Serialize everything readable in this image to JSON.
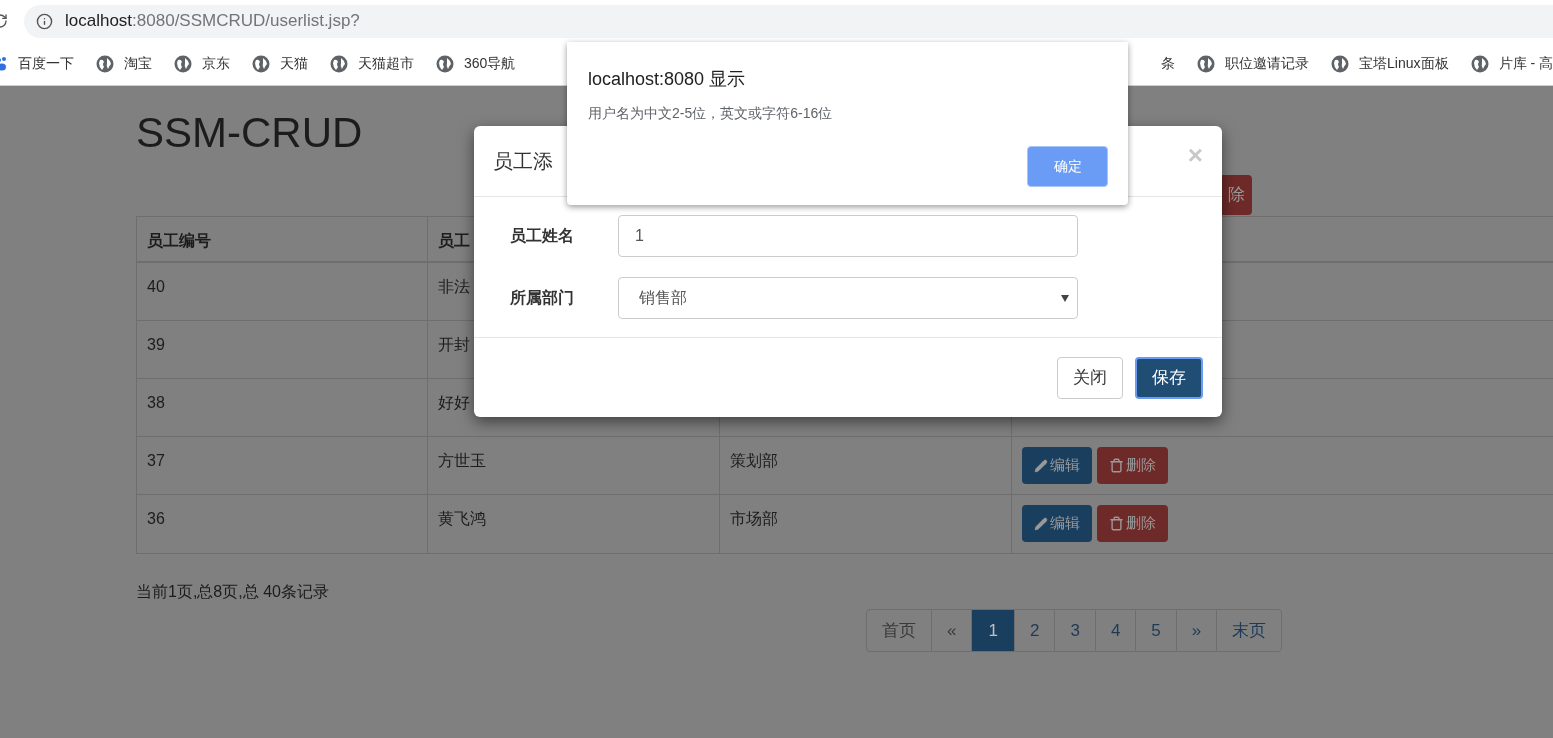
{
  "browser": {
    "url_host": "localhost",
    "url_rest": ":8080/SSMCRUD/userlist.jsp?",
    "bookmarks_left": [
      {
        "kind": "paw",
        "label": "百度一下"
      },
      {
        "kind": "site",
        "label": "淘宝"
      },
      {
        "kind": "site",
        "label": "京东"
      },
      {
        "kind": "site",
        "label": "天猫"
      },
      {
        "kind": "site",
        "label": "天猫超市"
      },
      {
        "kind": "site",
        "label": "360导航"
      }
    ],
    "bookmarks_right": [
      {
        "kind": "bare",
        "label": "条"
      },
      {
        "kind": "site",
        "label": "职位邀请记录"
      },
      {
        "kind": "site",
        "label": "宝塔Linux面板"
      },
      {
        "kind": "site",
        "label": "片库 - 高"
      }
    ]
  },
  "page": {
    "title": "SSM-CRUD",
    "toolbar_button": "除",
    "columns": [
      "员工编号",
      "员工"
    ],
    "rows": [
      {
        "cells": [
          "40",
          "非法"
        ],
        "actions": []
      },
      {
        "cells": [
          "39",
          "开封"
        ],
        "actions": []
      },
      {
        "cells": [
          "38",
          "好好"
        ],
        "actions": []
      },
      {
        "cells": [
          "37",
          "方世玉",
          "策划部"
        ],
        "actions": [
          {
            "kind": "edit",
            "label": "编辑"
          },
          {
            "kind": "delete",
            "label": "删除"
          }
        ]
      },
      {
        "cells": [
          "36",
          "黄飞鸿",
          "市场部"
        ],
        "actions": [
          {
            "kind": "edit",
            "label": "编辑"
          },
          {
            "kind": "delete",
            "label": "删除"
          }
        ]
      }
    ],
    "records": "当前1页,总8页,总 40条记录",
    "pagination": [
      {
        "label": "首页",
        "selected": false,
        "disabled": true
      },
      {
        "label": "«",
        "selected": false,
        "disabled": true
      },
      {
        "label": "1",
        "selected": true,
        "disabled": false
      },
      {
        "label": "2",
        "selected": false,
        "disabled": false
      },
      {
        "label": "3",
        "selected": false,
        "disabled": false
      },
      {
        "label": "4",
        "selected": false,
        "disabled": false
      },
      {
        "label": "5",
        "selected": false,
        "disabled": false
      },
      {
        "label": "»",
        "selected": false,
        "disabled": false
      },
      {
        "label": "末页",
        "selected": false,
        "disabled": false
      }
    ]
  },
  "modal": {
    "title": "员工添",
    "close": "×",
    "fields": [
      {
        "kind": "input",
        "label": "员工姓名",
        "value": "1"
      },
      {
        "kind": "select",
        "label": "所属部门",
        "value": "销售部"
      }
    ],
    "buttons": [
      {
        "kind": "default",
        "label": "关闭"
      },
      {
        "kind": "primary",
        "label": "保存"
      }
    ]
  },
  "alert": {
    "title": "localhost:8080 显示",
    "message": "用户名为中文2-5位，英文或字符6-16位",
    "button": "确定"
  }
}
